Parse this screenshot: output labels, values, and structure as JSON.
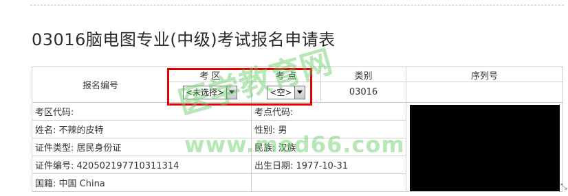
{
  "page_title": "03016脑电图专业(中级)考试报名申请表",
  "form": {
    "reg_no_label": "报名编号",
    "col_exam_area": "考 区",
    "col_exam_site": "考 点",
    "col_category": "类别",
    "col_serial": "序列号",
    "exam_area_select": "<未选择>",
    "exam_site_select": "<空>",
    "category_value": "03016",
    "rows": [
      {
        "left": "考区代码:",
        "right": "考点代码:"
      },
      {
        "left": "姓名: 不辣的皮特",
        "right": "性别: 男"
      },
      {
        "left": "证件类型: 居民身份证",
        "right": "民族: 汉族"
      },
      {
        "left": "证件编号: 420502197710311314",
        "right": "出生日期: 1977-10-31"
      },
      {
        "left": "国籍: 中国 China",
        "right": ""
      }
    ]
  },
  "watermark": {
    "text_cn": "医学教育网",
    "url": "www.med66.com"
  },
  "colors": {
    "highlight": "#e00000",
    "watermark": "#5fc85f",
    "photo_redaction": "#000000"
  },
  "resize_glyph": "⤡"
}
